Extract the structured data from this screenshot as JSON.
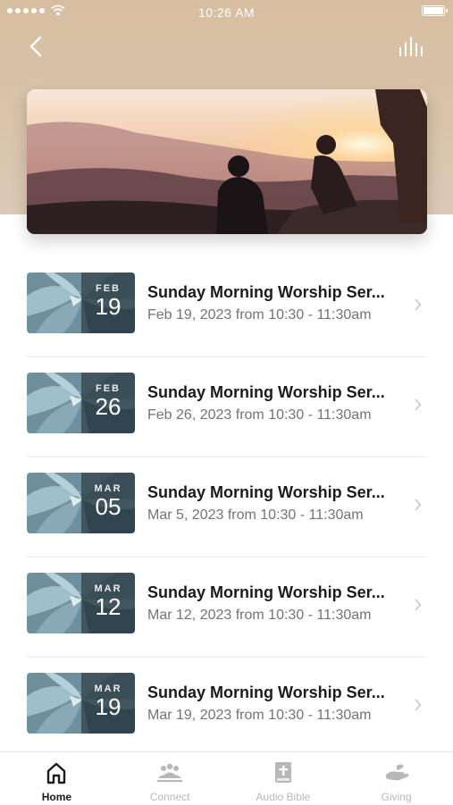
{
  "status_bar": {
    "time": "10:26 AM"
  },
  "header": {
    "back_icon": "chevron-left-icon",
    "action_icon": "equalizer-icon"
  },
  "hero": {
    "image": "people watching sunset over mountains"
  },
  "sermons": [
    {
      "month": "FEB",
      "day": "19",
      "title": "Sunday Morning Worship Ser...",
      "subtitle": "Feb 19, 2023 from 10:30 - 11:30am"
    },
    {
      "month": "FEB",
      "day": "26",
      "title": "Sunday Morning Worship Ser...",
      "subtitle": "Feb 26, 2023 from 10:30 - 11:30am"
    },
    {
      "month": "MAR",
      "day": "05",
      "title": "Sunday Morning Worship Ser...",
      "subtitle": "Mar 5, 2023 from 10:30 - 11:30am"
    },
    {
      "month": "MAR",
      "day": "12",
      "title": "Sunday Morning Worship Ser...",
      "subtitle": "Mar 12, 2023 from 10:30 - 11:30am"
    },
    {
      "month": "MAR",
      "day": "19",
      "title": "Sunday Morning Worship Ser...",
      "subtitle": "Mar 19, 2023 from 10:30 - 11:30am"
    }
  ],
  "tabs": [
    {
      "label": "Home",
      "icon": "home-icon",
      "active": true
    },
    {
      "label": "Connect",
      "icon": "people-icon",
      "active": false
    },
    {
      "label": "Audio Bible",
      "icon": "bible-icon",
      "active": false
    },
    {
      "label": "Giving",
      "icon": "giving-hand-icon",
      "active": false
    }
  ],
  "colors": {
    "header_bg": "#d7bea0",
    "active_tab": "#1b1b1b",
    "inactive_tab": "#b8b8b8"
  }
}
